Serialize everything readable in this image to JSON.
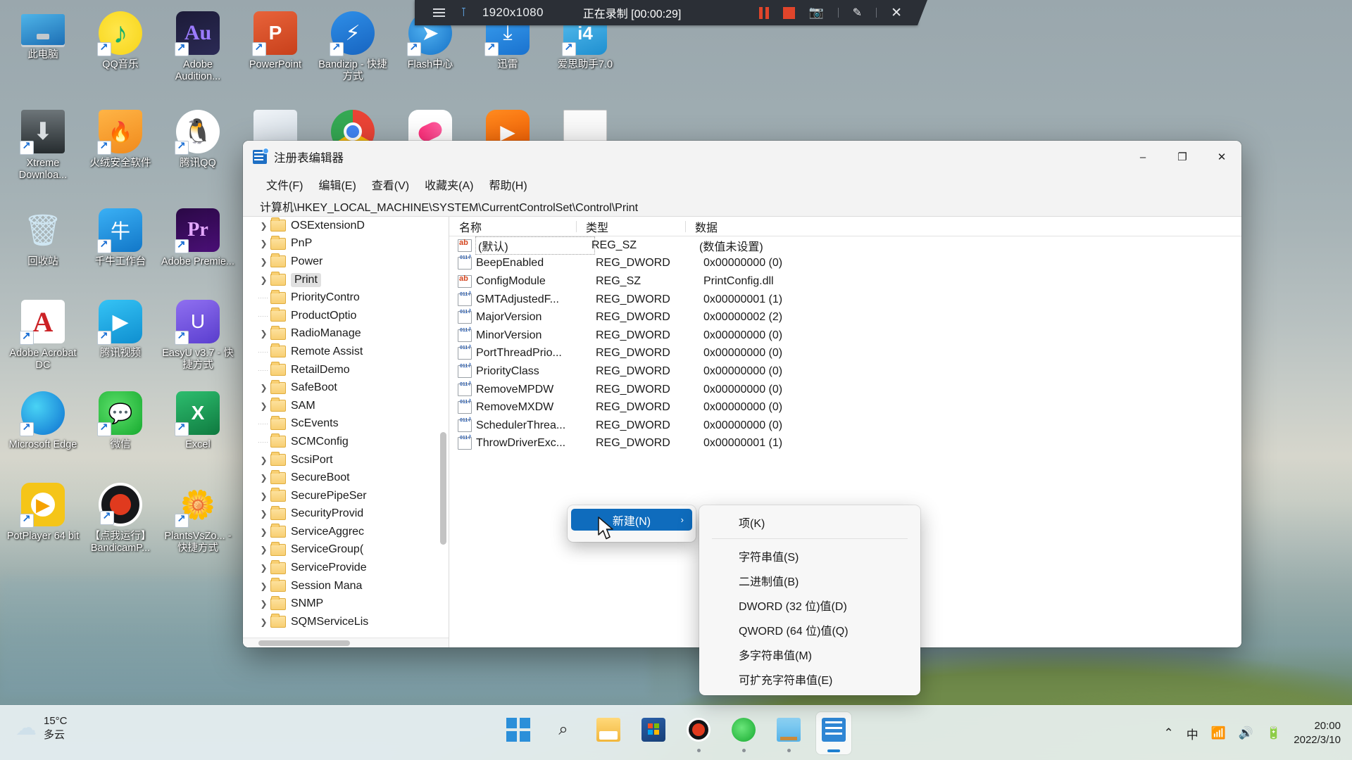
{
  "recorder": {
    "menu_icon": "hamburger-icon",
    "pin_icon": "pin-icon",
    "resolution": "1920x1080",
    "status": "正在录制 [00:00:29]",
    "pause_icon": "pause-icon",
    "stop_icon": "stop-icon",
    "camera_icon": "camera-icon",
    "pen_icon": "pen-icon",
    "close_icon": "close-icon"
  },
  "desktop": {
    "icons": [
      {
        "label": "此电脑",
        "icon": "this-pc-icon",
        "shortcut": false,
        "art": "ico-pc",
        "col": 0,
        "row": 0
      },
      {
        "label": "QQ音乐",
        "icon": "qq-music-icon",
        "shortcut": true,
        "art": "ico-qqmusic",
        "col": 1,
        "row": 0
      },
      {
        "label": "Adobe Audition...",
        "icon": "adobe-audition-icon",
        "shortcut": true,
        "art": "ico-au",
        "col": 2,
        "row": 0,
        "glyph": "Au"
      },
      {
        "label": "PowerPoint",
        "icon": "powerpoint-icon",
        "shortcut": true,
        "art": "ico-ppt",
        "col": 3,
        "row": 0,
        "glyph": "P"
      },
      {
        "label": "Bandizip - 快捷方式",
        "icon": "bandizip-icon",
        "shortcut": true,
        "art": "ico-bandizip",
        "col": 4,
        "row": 0,
        "glyph": "⚡"
      },
      {
        "label": "Flash中心",
        "icon": "flash-center-icon",
        "shortcut": true,
        "art": "ico-flash",
        "col": 5,
        "row": 0,
        "glyph": "➤"
      },
      {
        "label": "迅雷",
        "icon": "xunlei-icon",
        "shortcut": true,
        "art": "ico-xunlei",
        "col": 6,
        "row": 0,
        "glyph": "⤓"
      },
      {
        "label": "爱思助手7.0",
        "icon": "aisi-helper-icon",
        "shortcut": true,
        "art": "ico-aizhushou",
        "col": 7,
        "row": 0,
        "glyph": "i4"
      },
      {
        "label": "Xtreme Downloa...",
        "icon": "xtreme-download-manager-icon",
        "shortcut": true,
        "art": "ico-xtreme",
        "col": 0,
        "row": 1,
        "glyph": "⬇"
      },
      {
        "label": "火绒安全软件",
        "icon": "huorong-security-icon",
        "shortcut": true,
        "art": "ico-huorong",
        "col": 1,
        "row": 1,
        "glyph": "🔥"
      },
      {
        "label": "腾讯QQ",
        "icon": "tencent-qq-icon",
        "shortcut": true,
        "art": "ico-qq",
        "col": 2,
        "row": 1,
        "glyph": "🐧"
      },
      {
        "label": "",
        "icon": "folder-books-icon",
        "shortcut": false,
        "art": "ico-folder-books",
        "col": 3,
        "row": 1
      },
      {
        "label": "",
        "icon": "chrome-icon",
        "shortcut": false,
        "art": "ico-chrome",
        "col": 4,
        "row": 1
      },
      {
        "label": "",
        "icon": "app-pink-icon",
        "shortcut": false,
        "art": "ico-app1",
        "col": 5,
        "row": 1
      },
      {
        "label": "",
        "icon": "app-orange-play-icon",
        "shortcut": false,
        "art": "ico-app2",
        "col": 6,
        "row": 1,
        "glyph": "▶"
      },
      {
        "label": "",
        "icon": "document-icon",
        "shortcut": false,
        "art": "ico-doc",
        "col": 7,
        "row": 1
      },
      {
        "label": "回收站",
        "icon": "recycle-bin-icon",
        "shortcut": false,
        "art": "ico-recycle",
        "col": 0,
        "row": 2,
        "glyph": "🗑"
      },
      {
        "label": "千牛工作台",
        "icon": "qianniu-workbench-icon",
        "shortcut": true,
        "art": "ico-qianniu",
        "col": 1,
        "row": 2,
        "glyph": "牛"
      },
      {
        "label": "Adobe Premie...",
        "icon": "adobe-premiere-icon",
        "shortcut": true,
        "art": "ico-premiere",
        "col": 2,
        "row": 2,
        "glyph": "Pr"
      },
      {
        "label": "Adobe Acrobat DC",
        "icon": "adobe-acrobat-icon",
        "shortcut": true,
        "art": "ico-acrobat",
        "col": 0,
        "row": 3,
        "glyph": "A"
      },
      {
        "label": "腾讯视频",
        "icon": "tencent-video-icon",
        "shortcut": true,
        "art": "ico-tencentvideo",
        "col": 1,
        "row": 3,
        "glyph": "▶"
      },
      {
        "label": "EasyU v3.7 - 快捷方式",
        "icon": "easyu-icon",
        "shortcut": true,
        "art": "ico-easyu",
        "col": 2,
        "row": 3,
        "glyph": "U"
      },
      {
        "label": "Microsoft Edge",
        "icon": "microsoft-edge-icon",
        "shortcut": true,
        "art": "ico-edge",
        "col": 0,
        "row": 4
      },
      {
        "label": "微信",
        "icon": "wechat-icon",
        "shortcut": true,
        "art": "ico-wechat",
        "col": 1,
        "row": 4,
        "glyph": "💬"
      },
      {
        "label": "Excel",
        "icon": "excel-icon",
        "shortcut": true,
        "art": "ico-excel",
        "col": 2,
        "row": 4,
        "glyph": "X"
      },
      {
        "label": "PotPlayer 64 bit",
        "icon": "potplayer-icon",
        "shortcut": true,
        "art": "ico-potplayer",
        "col": 0,
        "row": 5
      },
      {
        "label": "【点我运行】BandicamP...",
        "icon": "bandicam-patch-icon",
        "shortcut": true,
        "art": "ico-bandicam",
        "col": 1,
        "row": 5
      },
      {
        "label": "PlantsVsZo... - 快捷方式",
        "icon": "plants-vs-zombies-icon",
        "shortcut": true,
        "art": "ico-pvz",
        "col": 2,
        "row": 5,
        "glyph": "🌼"
      }
    ]
  },
  "regedit": {
    "title": "注册表编辑器",
    "app_icon": "registry-editor-icon",
    "window_controls": {
      "minimize": "–",
      "maximize": "❐",
      "close": "✕"
    },
    "menu": [
      "文件(F)",
      "编辑(E)",
      "查看(V)",
      "收藏夹(A)",
      "帮助(H)"
    ],
    "address": "计算机\\HKEY_LOCAL_MACHINE\\SYSTEM\\CurrentControlSet\\Control\\Print",
    "tree": [
      {
        "label": "OSExtensionD",
        "expandable": true,
        "selected": false
      },
      {
        "label": "PnP",
        "expandable": true,
        "selected": false
      },
      {
        "label": "Power",
        "expandable": true,
        "selected": false
      },
      {
        "label": "Print",
        "expandable": true,
        "selected": true
      },
      {
        "label": "PriorityContro",
        "expandable": false,
        "selected": false
      },
      {
        "label": "ProductOptio",
        "expandable": false,
        "selected": false
      },
      {
        "label": "RadioManage",
        "expandable": true,
        "selected": false
      },
      {
        "label": "Remote Assist",
        "expandable": false,
        "selected": false
      },
      {
        "label": "RetailDemo",
        "expandable": false,
        "selected": false
      },
      {
        "label": "SafeBoot",
        "expandable": true,
        "selected": false
      },
      {
        "label": "SAM",
        "expandable": true,
        "selected": false
      },
      {
        "label": "ScEvents",
        "expandable": false,
        "selected": false
      },
      {
        "label": "SCMConfig",
        "expandable": false,
        "selected": false
      },
      {
        "label": "ScsiPort",
        "expandable": true,
        "selected": false
      },
      {
        "label": "SecureBoot",
        "expandable": true,
        "selected": false
      },
      {
        "label": "SecurePipeSer",
        "expandable": true,
        "selected": false
      },
      {
        "label": "SecurityProvid",
        "expandable": true,
        "selected": false
      },
      {
        "label": "ServiceAggrec",
        "expandable": true,
        "selected": false
      },
      {
        "label": "ServiceGroup(",
        "expandable": true,
        "selected": false
      },
      {
        "label": "ServiceProvide",
        "expandable": true,
        "selected": false
      },
      {
        "label": "Session Mana",
        "expandable": true,
        "selected": false
      },
      {
        "label": "SNMP",
        "expandable": true,
        "selected": false
      },
      {
        "label": "SQMServiceLis",
        "expandable": true,
        "selected": false
      }
    ],
    "list_headers": [
      "名称",
      "类型",
      "数据"
    ],
    "values": [
      {
        "name": "(默认)",
        "icon": "string-value-icon",
        "type": "REG_SZ",
        "data": "(数值未设置)",
        "default": true
      },
      {
        "name": "BeepEnabled",
        "icon": "dword-value-icon",
        "type": "REG_DWORD",
        "data": "0x00000000 (0)",
        "default": false
      },
      {
        "name": "ConfigModule",
        "icon": "string-value-icon",
        "type": "REG_SZ",
        "data": "PrintConfig.dll",
        "default": false
      },
      {
        "name": "GMTAdjustedF...",
        "icon": "dword-value-icon",
        "type": "REG_DWORD",
        "data": "0x00000001 (1)",
        "default": false
      },
      {
        "name": "MajorVersion",
        "icon": "dword-value-icon",
        "type": "REG_DWORD",
        "data": "0x00000002 (2)",
        "default": false
      },
      {
        "name": "MinorVersion",
        "icon": "dword-value-icon",
        "type": "REG_DWORD",
        "data": "0x00000000 (0)",
        "default": false
      },
      {
        "name": "PortThreadPrio...",
        "icon": "dword-value-icon",
        "type": "REG_DWORD",
        "data": "0x00000000 (0)",
        "default": false
      },
      {
        "name": "PriorityClass",
        "icon": "dword-value-icon",
        "type": "REG_DWORD",
        "data": "0x00000000 (0)",
        "default": false
      },
      {
        "name": "RemoveMPDW",
        "icon": "dword-value-icon",
        "type": "REG_DWORD",
        "data": "0x00000000 (0)",
        "default": false
      },
      {
        "name": "RemoveMXDW",
        "icon": "dword-value-icon",
        "type": "REG_DWORD",
        "data": "0x00000000 (0)",
        "default": false
      },
      {
        "name": "SchedulerThrea...",
        "icon": "dword-value-icon",
        "type": "REG_DWORD",
        "data": "0x00000000 (0)",
        "default": false
      },
      {
        "name": "ThrowDriverExc...",
        "icon": "dword-value-icon",
        "type": "REG_DWORD",
        "data": "0x00000001 (1)",
        "default": false
      }
    ]
  },
  "context_menu": {
    "new_label": "新建(N)",
    "chevron_icon": "chevron-right-icon",
    "submenu": [
      {
        "label": "项(K)",
        "separator_after": true
      },
      {
        "label": "字符串值(S)",
        "separator_after": false
      },
      {
        "label": "二进制值(B)",
        "separator_after": false
      },
      {
        "label": "DWORD (32 位)值(D)",
        "separator_after": false
      },
      {
        "label": "QWORD (64 位)值(Q)",
        "separator_after": false
      },
      {
        "label": "多字符串值(M)",
        "separator_after": false
      },
      {
        "label": "可扩充字符串值(E)",
        "separator_after": false
      }
    ]
  },
  "taskbar": {
    "weather": {
      "temperature": "15°C",
      "condition": "多云",
      "icon": "cloud-icon"
    },
    "apps": [
      {
        "name": "start-button",
        "icon": "windows-start-icon",
        "art": "ic-start",
        "state": "none"
      },
      {
        "name": "search-button",
        "icon": "search-icon",
        "art": "ic-search",
        "glyph": "⌕",
        "state": "none"
      },
      {
        "name": "file-explorer-button",
        "icon": "file-explorer-icon",
        "art": "ic-explorer",
        "state": "none"
      },
      {
        "name": "microsoft-store-button",
        "icon": "microsoft-store-icon",
        "art": "ic-store",
        "state": "none"
      },
      {
        "name": "bandicam-button",
        "icon": "bandicam-icon",
        "art": "ic-bandicam",
        "state": "dot"
      },
      {
        "name": "wechat-button",
        "icon": "wechat-icon",
        "art": "ic-wechat",
        "state": "dot"
      },
      {
        "name": "notes-button",
        "icon": "notes-icon",
        "art": "ic-notes",
        "state": "dot"
      },
      {
        "name": "registry-editor-button",
        "icon": "registry-editor-icon",
        "art": "ic-regedit",
        "state": "active"
      }
    ],
    "tray": {
      "chevron_icon": "chevron-up-icon",
      "ime": "中",
      "wifi_icon": "wifi-icon",
      "volume_icon": "volume-icon",
      "battery_icon": "battery-icon",
      "time": "20:00",
      "date": "2022/3/10"
    }
  }
}
